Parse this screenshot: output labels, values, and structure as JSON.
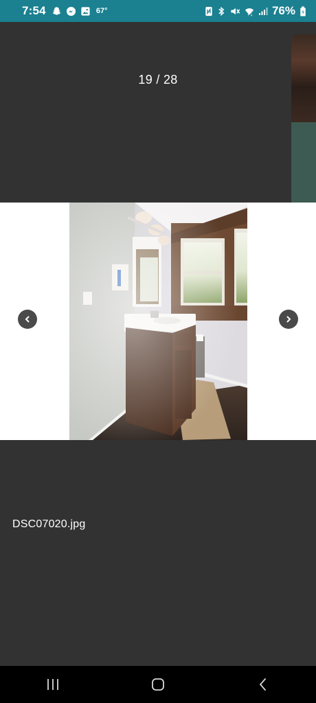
{
  "status_bar": {
    "time": "7:54",
    "temperature": "67°",
    "battery": "76%",
    "background": "#1b8090",
    "left_icons": [
      "snapchat-icon",
      "messenger-icon",
      "gallery-icon"
    ],
    "right_icons": [
      "nfc-icon",
      "bluetooth-icon",
      "mute-icon",
      "wifi-icon",
      "signal-icon",
      "battery-icon"
    ]
  },
  "viewer": {
    "counter": "19 / 28",
    "file_name": "DSC07020.jpg",
    "background": "#323232"
  },
  "system_nav": {
    "buttons": [
      "recent-apps",
      "home",
      "back"
    ]
  }
}
